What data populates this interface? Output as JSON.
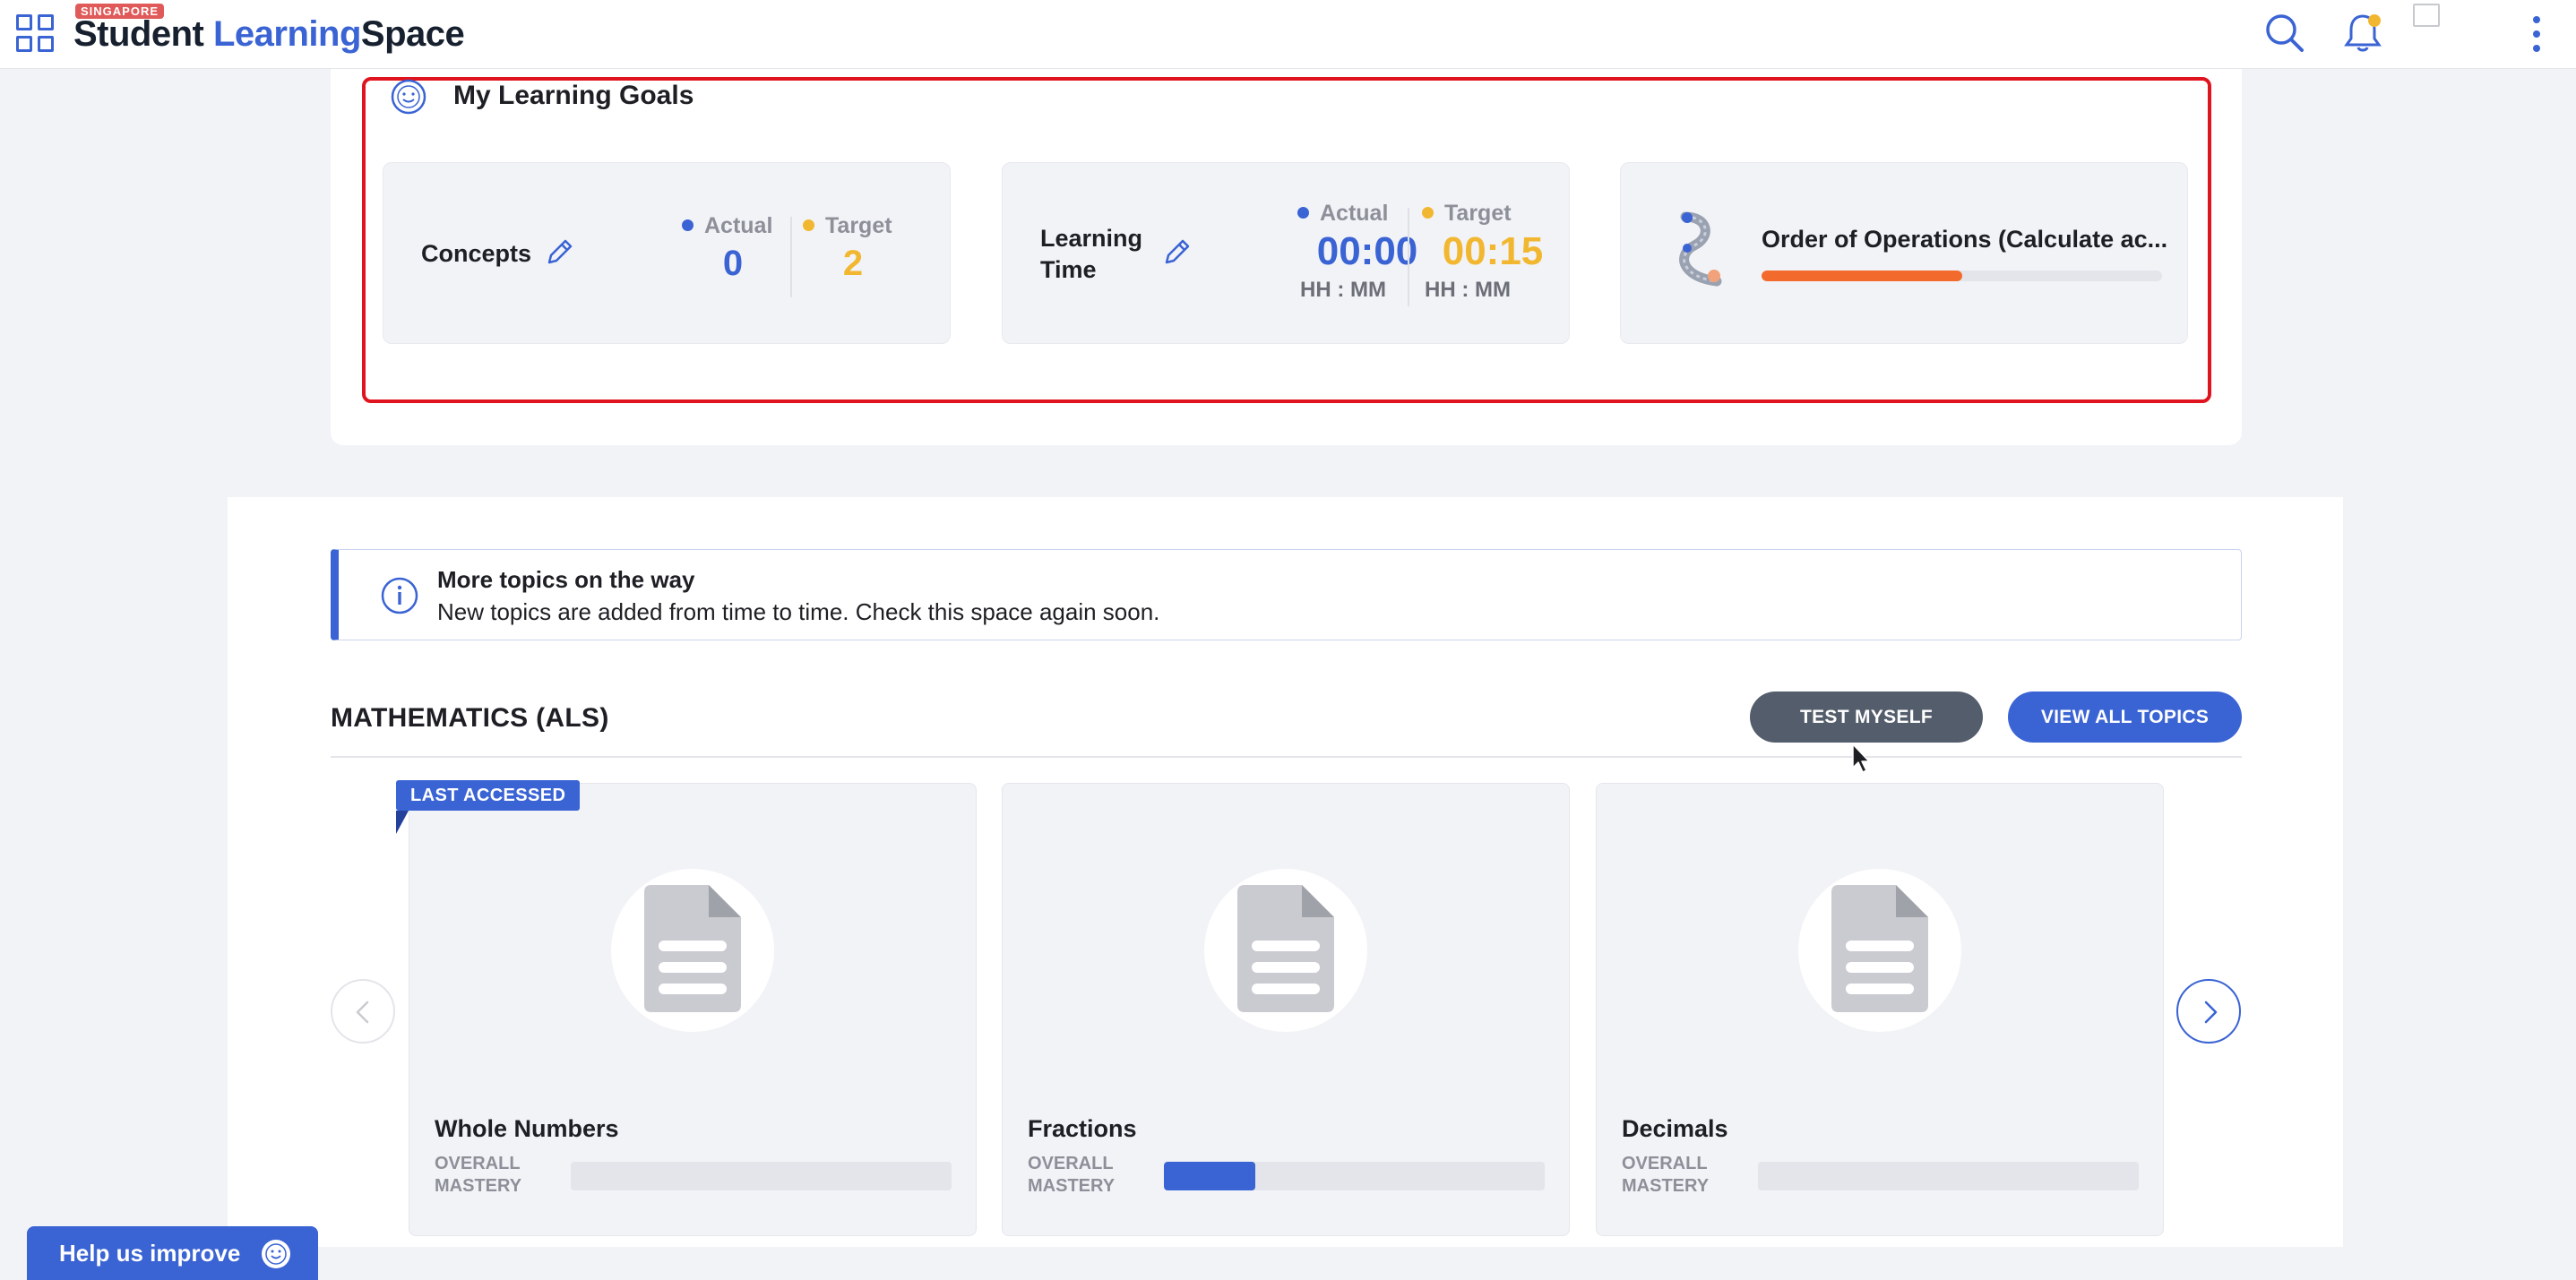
{
  "header": {
    "country_tag": "SINGAPORE",
    "brand_word_1": "Student",
    "brand_word_2": "Learning",
    "brand_word_3": "Space"
  },
  "goals": {
    "title": "My Learning Goals",
    "concepts": {
      "label": "Concepts",
      "actual_label": "Actual",
      "actual_value": "0",
      "target_label": "Target",
      "target_value": "2"
    },
    "learning_time": {
      "label_line1": "Learning",
      "label_line2": "Time",
      "actual_label": "Actual",
      "actual_value": "00:00",
      "actual_unit": "HH : MM",
      "target_label": "Target",
      "target_value": "00:15",
      "target_unit": "HH : MM"
    },
    "current_topic": {
      "name": "Order of Operations (Calculate ac...",
      "progress": 0.5
    }
  },
  "info_banner": {
    "title": "More topics on the way",
    "text": "New topics are added from time to time. Check this space again soon."
  },
  "section": {
    "title": "MATHEMATICS (ALS)",
    "test_button": "TEST MYSELF",
    "view_all_button": "VIEW ALL TOPICS"
  },
  "topics": [
    {
      "name": "Whole Numbers",
      "mastery_line1": "OVERALL",
      "mastery_line2": "MASTERY",
      "mastery": 0
    },
    {
      "name": "Fractions",
      "mastery_line1": "OVERALL",
      "mastery_line2": "MASTERY",
      "mastery": 0.24
    },
    {
      "name": "Decimals",
      "mastery_line1": "OVERALL",
      "mastery_line2": "MASTERY",
      "mastery": 0
    }
  ],
  "last_accessed_badge": "LAST ACCESSED",
  "help_button": "Help us improve",
  "colors": {
    "accent": "#3a63d4",
    "target_yellow": "#f2b731",
    "progress_orange": "#f26b2c",
    "highlight_red": "#e0141e",
    "test_button_gray": "#545d6b"
  }
}
